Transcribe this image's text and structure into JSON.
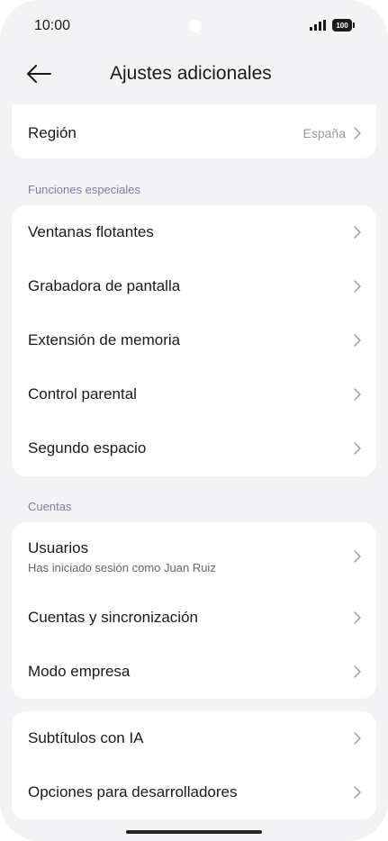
{
  "status_bar": {
    "time": "10:00",
    "battery": "100"
  },
  "header": {
    "title": "Ajustes adicionales",
    "back_icon": "arrow-left-icon"
  },
  "region": {
    "title": "Región",
    "value": "España"
  },
  "sections": {
    "special": {
      "header": "Funciones especiales",
      "items": [
        {
          "title": "Ventanas flotantes"
        },
        {
          "title": "Grabadora de pantalla"
        },
        {
          "title": "Extensión de memoria"
        },
        {
          "title": "Control parental"
        },
        {
          "title": "Segundo espacio"
        }
      ]
    },
    "accounts": {
      "header": "Cuentas",
      "items": [
        {
          "title": "Usuarios",
          "subtitle": "Has iniciado sesión como Juan Ruiz"
        },
        {
          "title": "Cuentas y sincronización"
        },
        {
          "title": "Modo empresa"
        }
      ]
    },
    "other": {
      "items": [
        {
          "title": "Subtítulos con IA"
        },
        {
          "title": "Opciones para desarrolladores"
        }
      ]
    }
  },
  "colors": {
    "background": "#f3f3f5",
    "card": "#ffffff",
    "text": "#1a1a1a",
    "secondary": "#9a9a9a",
    "section_header": "#7b7f9c"
  }
}
